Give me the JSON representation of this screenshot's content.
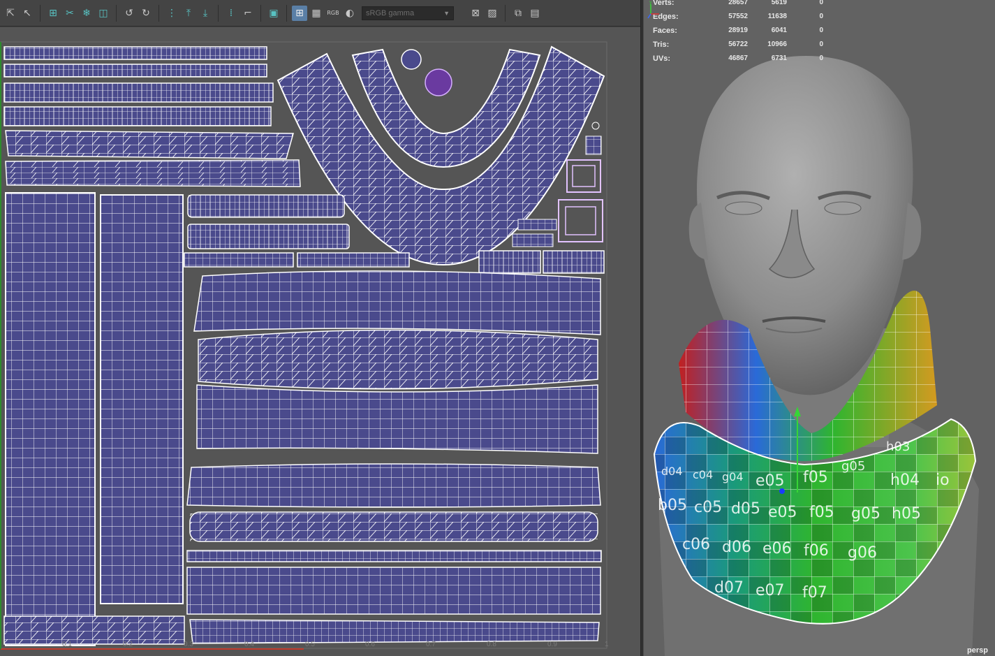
{
  "uv_editor": {
    "toolbar": {
      "color_management_value": "sRGB gamma",
      "rgb_label": "RGB",
      "icons": [
        "select-tool-icon",
        "tweak-tool-icon",
        "uv-grid-icon",
        "cut-uv-icon",
        "freeze-icon",
        "uv-shell-icon",
        "rotate-ccw-icon",
        "rotate-cw-icon",
        "stack-icon",
        "move-up-icon",
        "distribute-icon",
        "layout-icon",
        "texture-icon",
        "checker-icon",
        "wireframe-icon",
        "image-icon"
      ]
    },
    "axis_ticks": [
      "0.1",
      "0.2",
      "0.3",
      "0.4",
      "0.5",
      "0.6",
      "0.7",
      "0.8",
      "0.9",
      "1"
    ]
  },
  "viewport": {
    "stats": [
      {
        "label": "Verts:",
        "v1": "28657",
        "v2": "5619",
        "v3": "0"
      },
      {
        "label": "Edges:",
        "v1": "57552",
        "v2": "11638",
        "v3": "0"
      },
      {
        "label": "Faces:",
        "v1": "28919",
        "v2": "6041",
        "v3": "0"
      },
      {
        "label": "Tris:",
        "v1": "56722",
        "v2": "10966",
        "v3": "0"
      },
      {
        "label": "UVs:",
        "v1": "46867",
        "v2": "6731",
        "v3": "0"
      }
    ],
    "camera_label": "persp",
    "checker_labels": [
      "e05",
      "f05",
      "g05",
      "h03",
      "h04",
      "io",
      "b05",
      "c05",
      "d05",
      "e05",
      "f05",
      "g05",
      "h05",
      "c06",
      "d06",
      "e06",
      "f06",
      "g06",
      "d07",
      "e07",
      "f07",
      "d04",
      "c04",
      "g04"
    ]
  },
  "colors": {
    "uv_shell_fill": "#4a4a8c",
    "uv_wire": "#ffffff",
    "uv_background": "#555555",
    "viewport_background": "#626262",
    "head_gray": "#8a8a8a"
  }
}
